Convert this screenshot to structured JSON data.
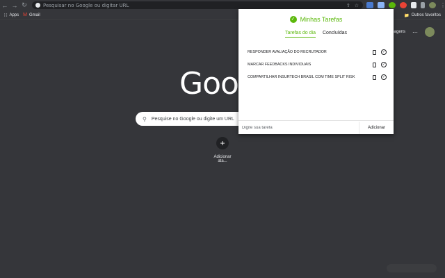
{
  "browser": {
    "omnibox_placeholder": "Pesquisar no Google ou digitar URL",
    "bookmarks": [
      {
        "label": "Apps",
        "icon": "apps-grid-icon"
      },
      {
        "label": "Gmail",
        "icon": "gmail-icon"
      }
    ],
    "other_bookmarks": "Outros favoritos"
  },
  "newtab": {
    "logo": "Google",
    "images_link": "Imagens",
    "search_placeholder": "Pesquise no Google ou digite um URL",
    "shortcut_label": "Adicionar ata..."
  },
  "popup": {
    "title": "Minhas Tarefas",
    "tabs": [
      {
        "label": "Tarefas do dia",
        "active": true
      },
      {
        "label": "Concluídas",
        "active": false
      }
    ],
    "tasks": [
      {
        "text": "RESPONDER AVALIAÇÃO DO RECRUTADOR"
      },
      {
        "text": "MARCAR FEEDBACKS INDIVIDUAIS"
      },
      {
        "text": "COMPARTILHAR INSURTECH BRASIL COM TIME SPLIT RISK"
      }
    ],
    "input_placeholder": "Digite sua tarefa",
    "add_label": "Adicionar",
    "accent_color": "#5bb80b"
  },
  "colors": {
    "background": "#35363a",
    "omnibox": "#202124"
  }
}
